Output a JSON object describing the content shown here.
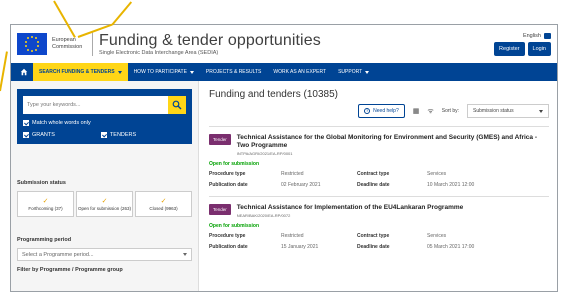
{
  "header": {
    "logo_text": "European Commission",
    "title": "Funding & tender opportunities",
    "subtitle": "Single Electronic Data Interchange Area (SEDIA)",
    "language": "English",
    "register_label": "Register",
    "login_label": "Login"
  },
  "nav": {
    "items": [
      {
        "label": "SEARCH FUNDING & TENDERS"
      },
      {
        "label": "HOW TO PARTICIPATE"
      },
      {
        "label": "PROJECTS & RESULTS"
      },
      {
        "label": "WORK AS AN EXPERT"
      },
      {
        "label": "SUPPORT"
      }
    ]
  },
  "sidebar": {
    "search_placeholder": "Type your keywords...",
    "match_whole_words": "Match whole words only",
    "grants_label": "GRANTS",
    "tenders_label": "TENDERS",
    "submission_status_title": "Submission status",
    "status_tiles": [
      {
        "label": "Forthcoming (37)"
      },
      {
        "label": "Open for submission (263)"
      },
      {
        "label": "Closed (9963)"
      }
    ],
    "programming_period_title": "Programming period",
    "programme_select": "Select a Programme period...",
    "filter_title": "Filter by Programme / Programme group"
  },
  "main": {
    "results_title": "Funding and tenders (10385)",
    "need_help": "Need help?",
    "sort_label": "Sort by:",
    "sort_value": "Submission status",
    "cards": [
      {
        "tag": "Tender",
        "title": "Technical Assistance for the Global Monitoring for Environment and Security (GMES) and Africa - Two Programme",
        "id": "INTPA/AGRI/2021/EA-RP/0001",
        "status": "Open for submission",
        "procedure_type_label": "Procedure type",
        "procedure_type": "Restricted",
        "contract_type_label": "Contract type",
        "contract_type": "Services",
        "publication_label": "Publication date",
        "publication_date": "02 February 2021",
        "deadline_label": "Deadline date",
        "deadline_date": "10 March 2021 12:00"
      },
      {
        "tag": "Tender",
        "title": "Technical Assistance for Implementation of the EU4Lankaran Programme",
        "id": "NEAR/BAK/2020/EA-RP/0072",
        "status": "Open for submission",
        "procedure_type_label": "Procedure type",
        "procedure_type": "Restricted",
        "contract_type_label": "Contract type",
        "contract_type": "Services",
        "publication_label": "Publication date",
        "publication_date": "15 January 2021",
        "deadline_label": "Deadline date",
        "deadline_date": "05 March 2021 17:00"
      }
    ]
  },
  "colors": {
    "brand_blue": "#004494",
    "accent_yellow": "#ffd617",
    "tag_purple": "#7a2e6e",
    "open_green": "#00a000"
  }
}
